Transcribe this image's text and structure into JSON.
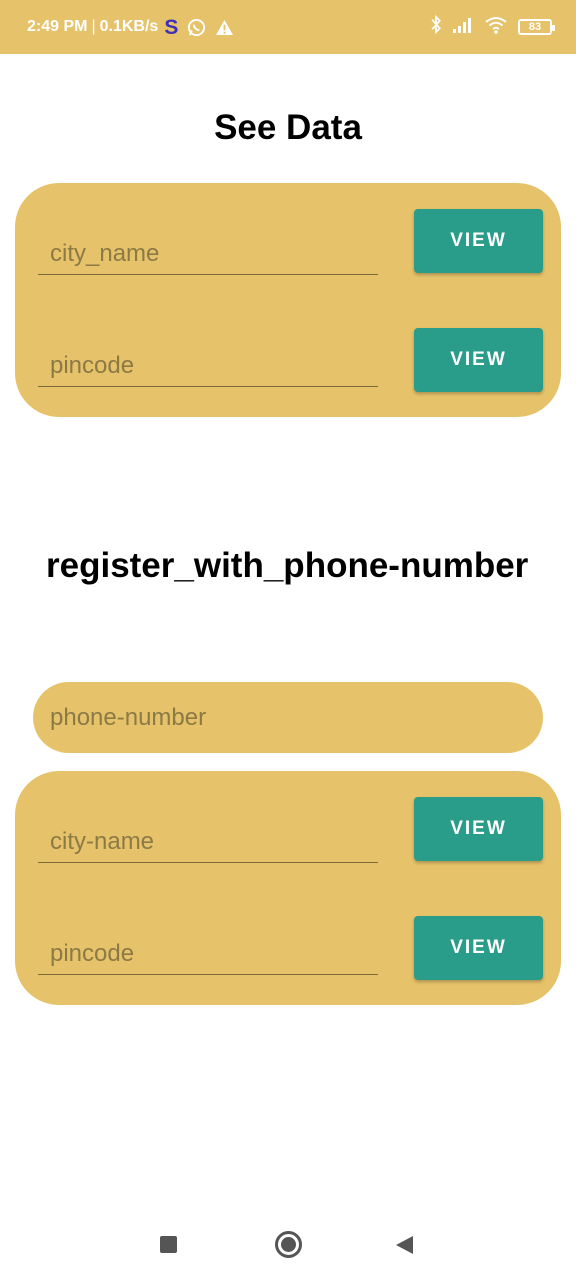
{
  "status_bar": {
    "time": "2:49 PM",
    "separator": "|",
    "speed": "0.1KB/s",
    "app_letter": "S",
    "battery": "83",
    "icons": [
      "s-app-icon",
      "whatsapp-icon",
      "warning-icon",
      "bluetooth-icon",
      "signal-icon",
      "wifi-icon",
      "battery-icon"
    ]
  },
  "see_data": {
    "title": "See Data",
    "city_placeholder": "city_name",
    "pincode_placeholder": "pincode",
    "view_label": "VIEW"
  },
  "register": {
    "title": "register_with_phone-number",
    "phone_placeholder": "phone-number",
    "city_placeholder": "city-name",
    "pincode_placeholder": "pincode",
    "view_label": "VIEW"
  },
  "colors": {
    "accent": "#e6c36a",
    "button": "#2a9d8a"
  },
  "nav": {
    "icons": [
      "recents-square-icon",
      "home-circle-icon",
      "back-triangle-icon"
    ]
  }
}
